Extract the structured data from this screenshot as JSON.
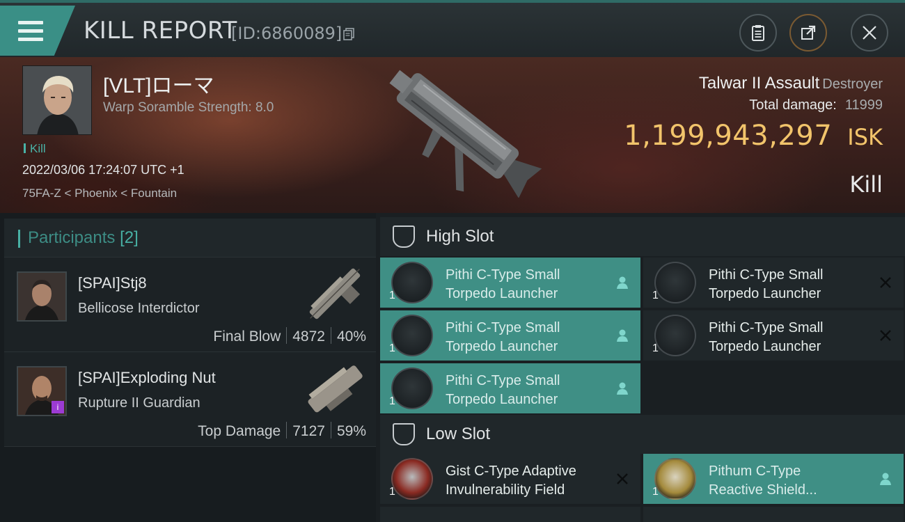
{
  "header": {
    "title": "KILL REPORT",
    "report_id": "[ID:6860089]"
  },
  "victim": {
    "name": "[VLT]ローマ",
    "warp_scramble": "Warp Soramble Strength: 8.0",
    "kill_tag": "Kill",
    "date": "2022/03/06 17:24:07 UTC +1",
    "location": "75FA-Z < Phoenix < Fountain",
    "ship_name": "Talwar II Assault",
    "ship_class": "Destroyer",
    "total_damage_label": "Total damage:",
    "total_damage_value": "11999",
    "isk_value": "1,199,943,297",
    "isk_unit": "ISK",
    "result": "Kill"
  },
  "participants": {
    "title": "Participants",
    "count": "[2]",
    "items": [
      {
        "name": "[SPAI]Stj8",
        "ship": "Bellicose Interdictor",
        "role": "Final Blow",
        "damage": "4872",
        "percent": "40%"
      },
      {
        "name": "[SPAI]Exploding Nut",
        "ship": "Rupture II Guardian",
        "role": "Top Damage",
        "damage": "7127",
        "percent": "59%"
      }
    ]
  },
  "slots": {
    "high": {
      "title": "High Slot",
      "modules": [
        {
          "name_line1": "Pithi C-Type Small",
          "name_line2": "Torpedo Launcher",
          "qty": "1",
          "status": "owned"
        },
        {
          "name_line1": "Pithi C-Type Small",
          "name_line2": "Torpedo Launcher",
          "qty": "1",
          "status": "destroyed"
        },
        {
          "name_line1": "Pithi C-Type Small",
          "name_line2": "Torpedo Launcher",
          "qty": "1",
          "status": "owned"
        },
        {
          "name_line1": "Pithi C-Type Small",
          "name_line2": "Torpedo Launcher",
          "qty": "1",
          "status": "destroyed"
        },
        {
          "name_line1": "Pithi C-Type Small",
          "name_line2": "Torpedo Launcher",
          "qty": "1",
          "status": "owned"
        }
      ]
    },
    "low": {
      "title": "Low Slot",
      "modules": [
        {
          "name_line1": "Gist C-Type Adaptive",
          "name_line2": "Invulnerability Field",
          "qty": "1",
          "status": "destroyed"
        },
        {
          "name_line1": "Pithum C-Type",
          "name_line2": "Reactive Shield...",
          "qty": "1",
          "status": "owned"
        }
      ]
    }
  },
  "colors": {
    "accent_teal": "#3f8f85",
    "isk_gold": "#f2c46b"
  }
}
